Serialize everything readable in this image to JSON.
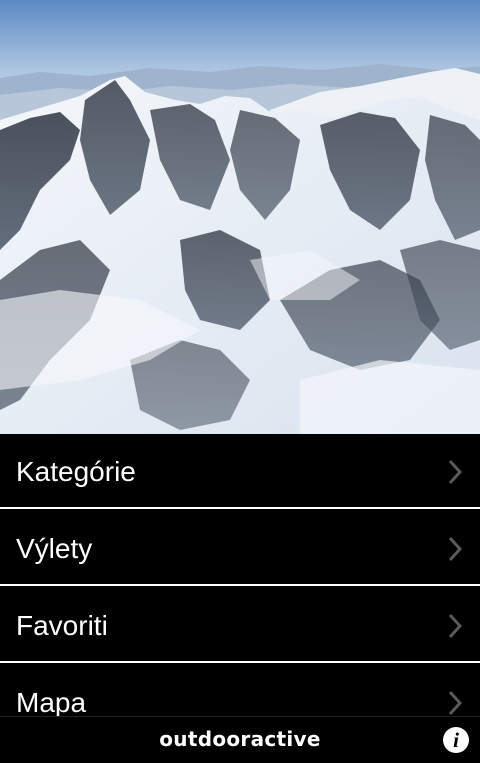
{
  "hero": {
    "image": "snowy-mountain-range-photo"
  },
  "menu": {
    "items": [
      {
        "label": "Kategórie",
        "icon": "chevron-right-icon"
      },
      {
        "label": "Výlety",
        "icon": "chevron-right-icon"
      },
      {
        "label": "Favoriti",
        "icon": "chevron-right-icon"
      },
      {
        "label": "Mapa",
        "icon": "chevron-right-icon"
      }
    ]
  },
  "footer": {
    "brand": "outdooractive",
    "info_icon": "info-icon"
  },
  "colors": {
    "background": "#000000",
    "text": "#ffffff",
    "divider": "#ffffff",
    "chevron": "#5a5a5a"
  }
}
